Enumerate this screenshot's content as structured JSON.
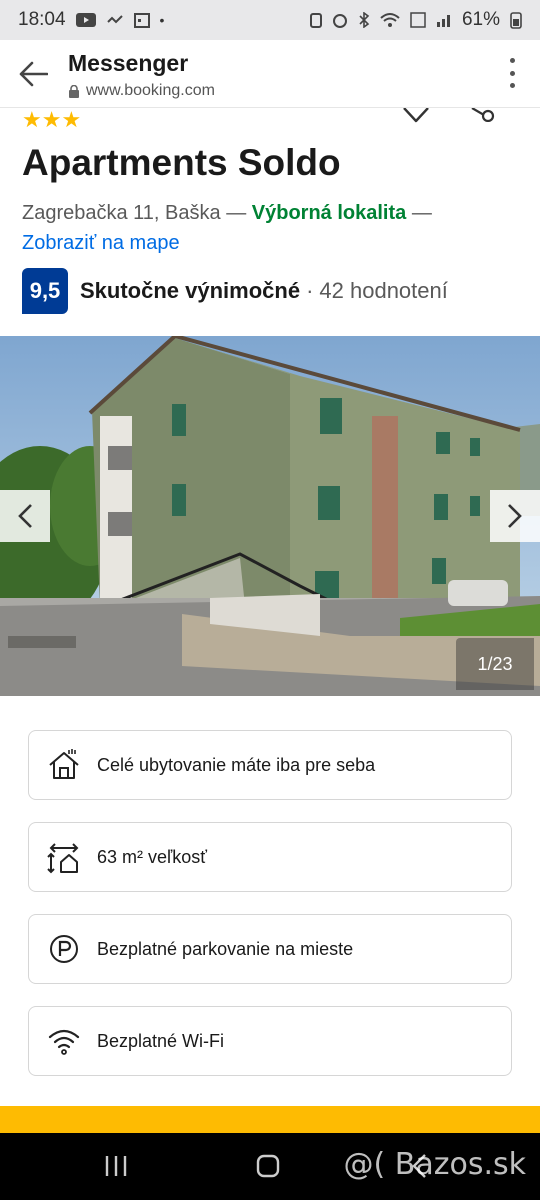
{
  "status_bar": {
    "time": "18:04",
    "battery": "61%"
  },
  "browser": {
    "title": "Messenger",
    "url": "www.booking.com"
  },
  "property": {
    "stars": "★★★",
    "name": "Apartments Soldo",
    "address": "Zagrebačka 11, Baška",
    "separator": "—",
    "location_label": "Výborná lokalita",
    "map_link": "Zobraziť na mape",
    "score": "9,5",
    "score_text": "Skutočne výnimočné",
    "dot": "·",
    "reviews": "42 hodnotení"
  },
  "gallery": {
    "counter": "1/23"
  },
  "facilities": [
    {
      "label": "Celé ubytovanie máte iba pre seba",
      "icon": "house-icon"
    },
    {
      "label": "63 m² veľkosť",
      "icon": "size-icon"
    },
    {
      "label": "Bezplatné parkovanie na mieste",
      "icon": "parking-icon"
    },
    {
      "label": "Bezplatné Wi-Fi",
      "icon": "wifi-icon"
    }
  ],
  "watermark": "@( Bazos.sk",
  "colors": {
    "score_badge": "#003b95",
    "location_green": "#008234",
    "link_blue": "#006ce4",
    "star_yellow": "#febb02"
  }
}
